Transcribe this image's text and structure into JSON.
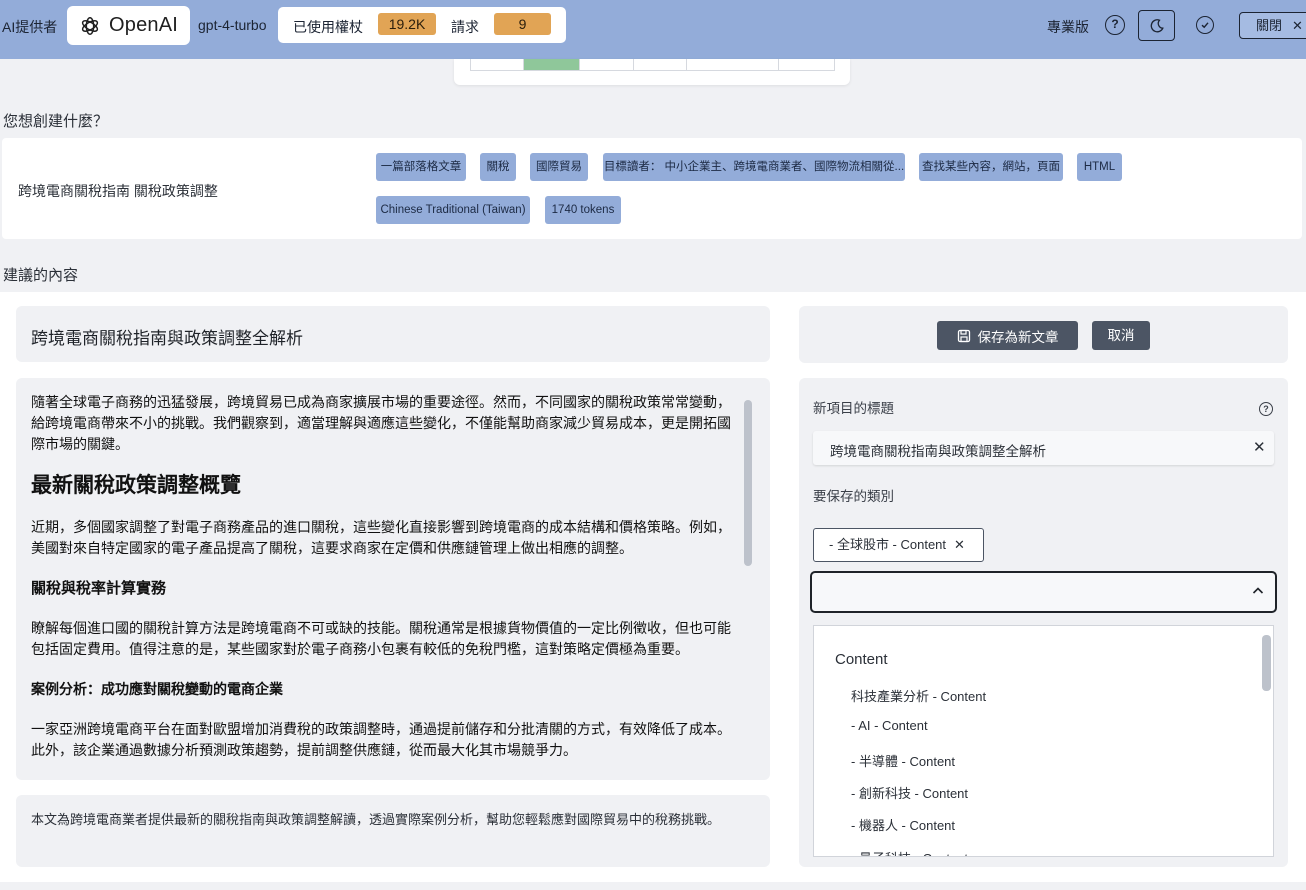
{
  "topbar": {
    "provider_label": "AI提供者",
    "brand": "OpenAI",
    "model": "gpt-4-turbo",
    "tokens_label": "已使用權杖",
    "tokens_value": "19.2K",
    "requests_label": "請求",
    "requests_value": "9",
    "plan": "專業版",
    "help": "?",
    "close_label": "關閉",
    "close_x": "✕"
  },
  "create": {
    "heading": "您想創建什麼？",
    "prompt": "跨境電商關稅指南 關稅政策調整",
    "chips": [
      "一篇部落格文章",
      "關稅",
      "國際貿易",
      "目標讀者： 中小企業主、跨境電商業者、國際物流相關從...",
      "查找某些內容，網站，頁面",
      "HTML",
      "Chinese Traditional (Taiwan)",
      "1740 tokens"
    ]
  },
  "suggested": {
    "heading": "建議的內容",
    "title": "跨境電商關稅指南與政策調整全解析",
    "intro": "隨著全球電子商務的迅猛發展，跨境貿易已成為商家擴展市場的重要途徑。然而，不同國家的關稅政策常常變動，給跨境電商帶來不小的挑戰。我們觀察到，適當理解與適應這些變化，不僅能幫助商家減少貿易成本，更是開拓國際市場的關鍵。",
    "h2": "最新關稅政策調整概覽",
    "p2": "近期，多個國家調整了對電子商務產品的進口關稅，這些變化直接影響到跨境電商的成本結構和價格策略。例如，美國對來自特定國家的電子產品提高了關稅，這要求商家在定價和供應鏈管理上做出相應的調整。",
    "h3": "關稅與稅率計算實務",
    "p3": "瞭解每個進口國的關稅計算方法是跨境電商不可或缺的技能。關稅通常是根據貨物價值的一定比例徵收，但也可能包括固定費用。值得注意的是，某些國家對於電子商務小包裹有較低的免稅門檻，這對策略定價極為重要。",
    "h4": "案例分析：成功應對關稅變動的電商企業",
    "p4": "一家亞洲跨境電商平台在面對歐盟增加消費稅的政策調整時，通過提前儲存和分批清關的方式，有效降低了成本。此外，該企業通過數據分析預測政策趨勢，提前調整供應鏈，從而最大化其市場競爭力。",
    "summary": "本文為跨境電商業者提供最新的關稅指南與政策調整解讀，透過實際案例分析，幫助您輕鬆應對國際貿易中的稅務挑戰。"
  },
  "save_panel": {
    "save_label": "保存為新文章",
    "cancel_label": "取消",
    "new_title_label": "新項目的標題",
    "new_title_value": "跨境電商關稅指南與政策調整全解析",
    "clear_x": "✕",
    "category_label": "要保存的類別",
    "selected_category": "- 全球股市 - Content",
    "remove_x": "✕",
    "dropdown_group": "Content",
    "dropdown_items": [
      "科技產業分析 - Content",
      "- AI - Content",
      "- 半導體 - Content",
      "- 創新科技 - Content",
      "- 機器人 - Content",
      "- 量子科技 - Content"
    ]
  }
}
